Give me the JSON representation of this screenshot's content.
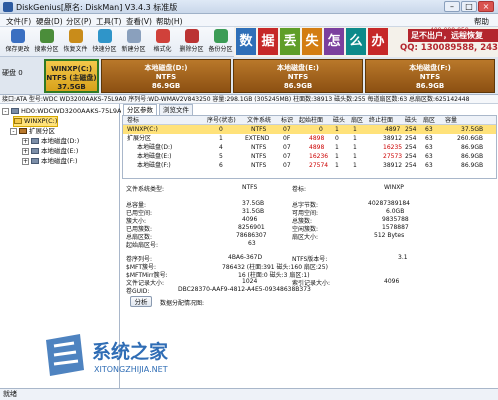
{
  "window": {
    "title": "DiskGenius[原名: DiskMan] V3.4.3 标准版"
  },
  "menu": [
    "文件(F)",
    "硬盘(D)",
    "分区(P)",
    "工具(T)",
    "查看(V)",
    "帮助(H)"
  ],
  "menu_extra": "帮助",
  "toolbar": [
    {
      "label": "保存更改",
      "icon": "save-icon",
      "color": "#3a6fc1"
    },
    {
      "label": "搜索分区",
      "icon": "search-partition-icon",
      "color": "#4b8d3a"
    },
    {
      "label": "恢复文件",
      "icon": "recover-file-icon",
      "color": "#c98c1a"
    },
    {
      "label": "快速分区",
      "icon": "quick-partition-icon",
      "color": "#2f95c9"
    },
    {
      "label": "新建分区",
      "icon": "new-partition-icon",
      "color": "#8aa0bd"
    },
    {
      "label": "格式化",
      "icon": "format-icon",
      "color": "#d0413a"
    },
    {
      "label": "删除分区",
      "icon": "delete-partition-icon",
      "color": "#b33"
    },
    {
      "label": "备份分区",
      "icon": "backup-partition-icon",
      "color": "#3b9c56"
    }
  ],
  "ad": {
    "chars": [
      "数",
      "据",
      "丢",
      "失",
      "怎",
      "么",
      "办"
    ],
    "colors": [
      "#2e6fb8",
      "#c62828",
      "#5f9e28",
      "#d37d12",
      "#7b3f9e",
      "#0d8a8a",
      "#c62828"
    ],
    "line1": "足不出户，远程恢复",
    "line2": "QQ: 130089588, 2433789417",
    "phone": "400-008-958"
  },
  "disk": {
    "label": "硬盘 0",
    "interface_caption": "接口:ATA",
    "partitions": [
      {
        "name": "WINXP(C:)",
        "fs": "NTFS (主磁盘)",
        "size": "37.5GB"
      },
      {
        "name": "本地磁盘(D:)",
        "fs": "NTFS",
        "size": "86.9GB"
      },
      {
        "name": "本地磁盘(E:)",
        "fs": "NTFS",
        "size": "86.9GB"
      },
      {
        "name": "本地磁盘(F:)",
        "fs": "NTFS",
        "size": "86.9GB"
      }
    ]
  },
  "infoline": "接口:ATA  型号:WDC WD3200AAKS-75L9A0  序列号:WD-WMAV2V843250  容量:298.1GB (305245MB)  柱面数:38913  磁头数:255  每道扇区数:63  总扇区数:625142448",
  "tree": {
    "disk": "HD0:WDCWD3200AAKS-75L9A0",
    "items": [
      "WINXP(C:)",
      "扩展分区",
      "本地磁盘(D:)",
      "本地磁盘(E:)",
      "本地磁盘(F:)"
    ]
  },
  "tabs": [
    "分区参数",
    "浏览文件"
  ],
  "table": {
    "headers": [
      "卷标",
      "序号(状态)",
      "文件系统",
      "标识",
      "起始柱面",
      "磁头",
      "扇区",
      "终止柱面",
      "磁头",
      "扇区",
      "容量"
    ],
    "rows": [
      [
        "WINXP(C:)",
        "0",
        "NTFS",
        "07",
        "0",
        "1",
        "1",
        "4897",
        "254",
        "63",
        "37.5GB"
      ],
      [
        "扩展分区",
        "1",
        "EXTEND",
        "0F",
        "4898",
        "0",
        "1",
        "38912",
        "254",
        "63",
        "260.6GB"
      ],
      [
        "本地磁盘(D:)",
        "4",
        "NTFS",
        "07",
        "4898",
        "1",
        "1",
        "16235",
        "254",
        "63",
        "86.9GB"
      ],
      [
        "本地磁盘(E:)",
        "5",
        "NTFS",
        "07",
        "16236",
        "1",
        "1",
        "27573",
        "254",
        "63",
        "86.9GB"
      ],
      [
        "本地磁盘(F:)",
        "6",
        "NTFS",
        "07",
        "27574",
        "1",
        "1",
        "38912",
        "254",
        "63",
        "86.9GB"
      ]
    ]
  },
  "details": {
    "fs_type_label": "文件系统类型:",
    "fs_type": "NTFS",
    "vol_label_label": "卷标:",
    "vol_label": "WINXP",
    "left": [
      [
        "总容量:",
        "37.5GB"
      ],
      [
        "已用空间:",
        "31.5GB"
      ],
      [
        "簇大小:",
        "4096"
      ],
      [
        "已用簇数:",
        "8256901"
      ],
      [
        "总扇区数:",
        "78686307"
      ],
      [
        "起始扇区号:",
        "63"
      ]
    ],
    "right": [
      [
        "总字节数:",
        "40287389184"
      ],
      [
        "可用空间:",
        "6.0GB"
      ],
      [
        "总簇数:",
        "9835788"
      ],
      [
        "空闲簇数:",
        "1578887"
      ],
      [
        "扇区大小:",
        "512 Bytes"
      ],
      [
        "",
        ""
      ]
    ],
    "serial_label": "卷序列号:",
    "serial": "4BA6-367D",
    "ntfs_ver_label": "NTFS版本号:",
    "ntfs_ver": "3.1",
    "mft_label": "$MFT簇号:",
    "mft": "786432 (柱面:391 磁头:160 扇区:25)",
    "mftmirr_label": "$MFTMirr簇号:",
    "mftmirr": "16 (柱面:0 磁头:3 扇区:1)",
    "rec_label": "文件记录大小:",
    "rec": "1024",
    "idx_label": "索引记录大小:",
    "idx": "4096",
    "guid_label": "卷GUID:",
    "guid": "DBC28370-AAF9-4812-A4E5-09348638B373",
    "analyze_btn": "分析",
    "alloc_label": "数据分配情况图:"
  },
  "status": "就绪",
  "watermark": {
    "title": "系统之家",
    "sub": "XITONGZHIJIA.NET"
  }
}
